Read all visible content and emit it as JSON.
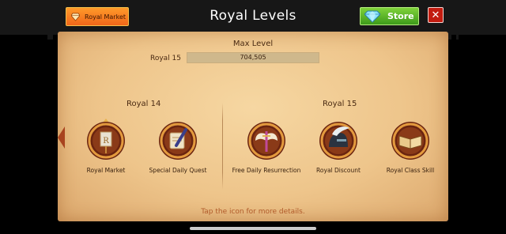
{
  "header": {
    "title": "Royal Levels",
    "market_button_label": "Royal Market",
    "store_button_label": "Store",
    "close_symbol": "✕"
  },
  "progress": {
    "heading": "Max Level",
    "current_level_label": "Royal 15",
    "points_text": "704,505",
    "fill_fraction": 1.0
  },
  "groups": [
    {
      "title": "Royal 14",
      "perks": [
        {
          "label": "Royal Market",
          "icon": "royal-banner-icon"
        },
        {
          "label": "Special Daily Quest",
          "icon": "scroll-quill-icon"
        }
      ]
    },
    {
      "title": "Royal 15",
      "perks": [
        {
          "label": "Free Daily Resurrection",
          "icon": "winged-sword-icon"
        },
        {
          "label": "Royal Discount",
          "icon": "feathered-helmet-icon"
        },
        {
          "label": "Royal Class Skill",
          "icon": "open-book-icon"
        }
      ]
    }
  ],
  "hint": "Tap the icon for more details.",
  "colors": {
    "market_button": "#f0661a",
    "store_button": "#3d9a1a",
    "close_button": "#c21c10",
    "parchment": "#eec58b",
    "medal_ring": "#c8782a"
  }
}
